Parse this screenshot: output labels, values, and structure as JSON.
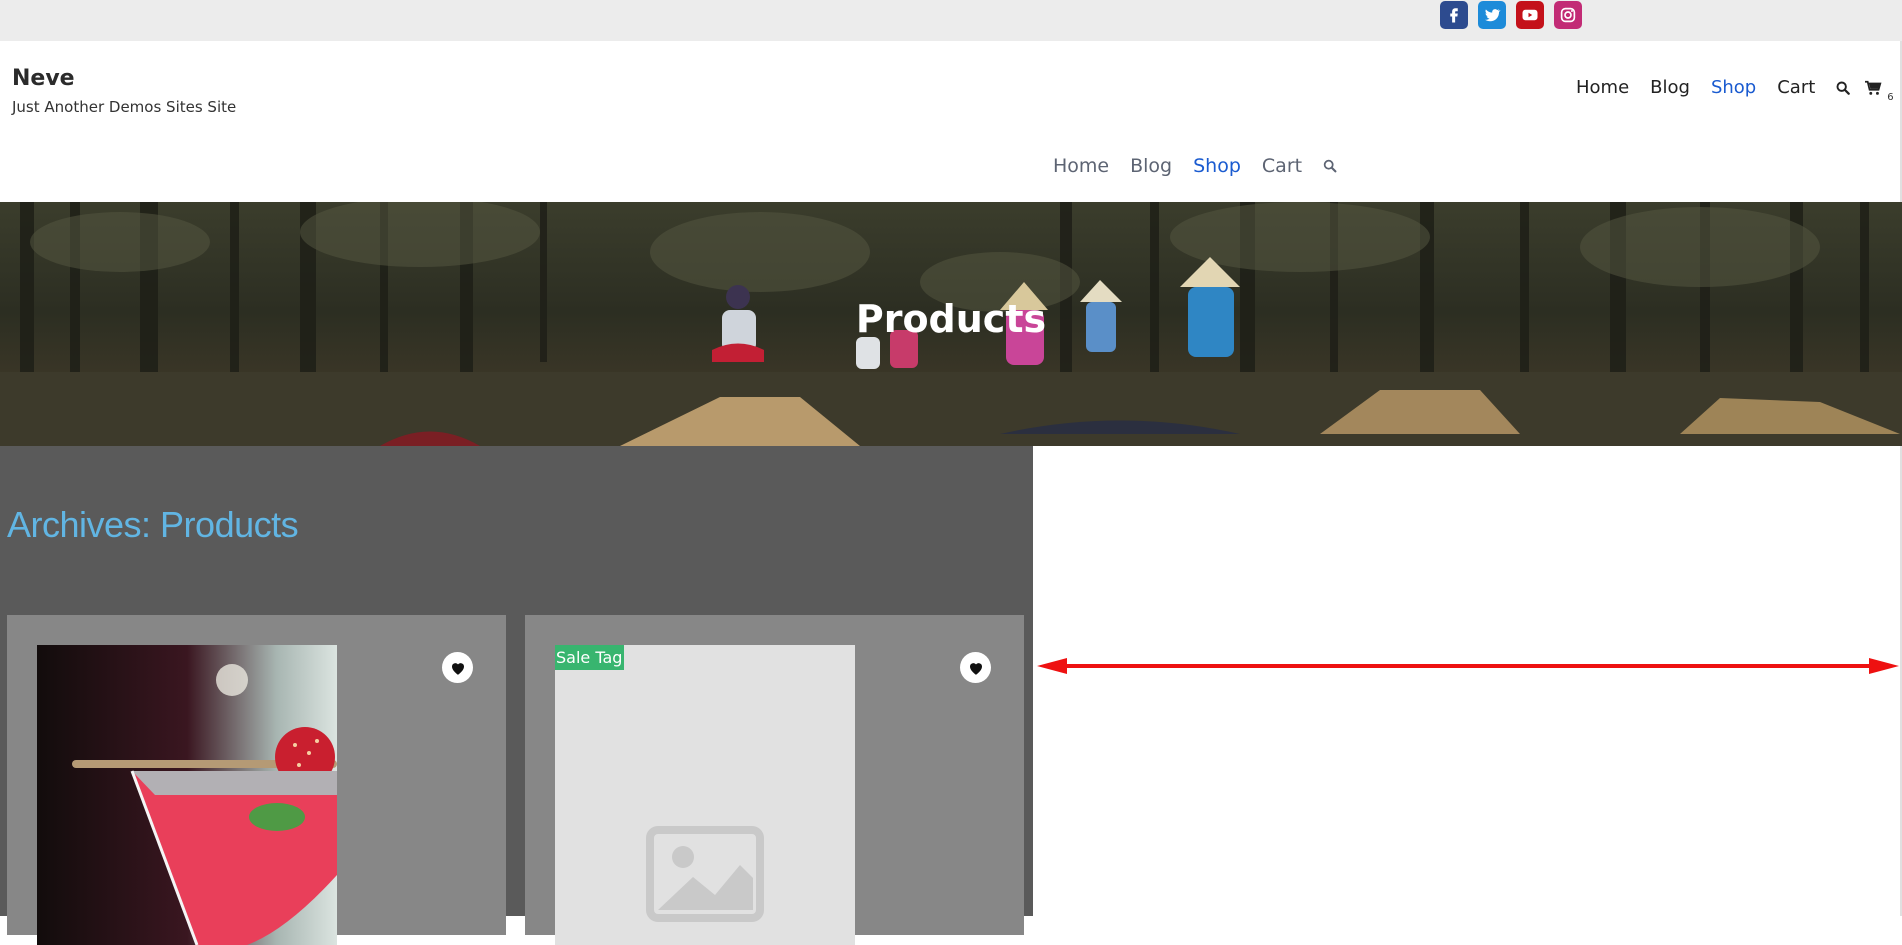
{
  "topbar": {
    "social": [
      "facebook-icon",
      "twitter-icon",
      "youtube-icon",
      "instagram-icon"
    ]
  },
  "header": {
    "site_title": "Neve",
    "tagline": "Just Another Demos Sites Site",
    "primary_nav": [
      "Home",
      "Blog",
      "Shop",
      "Cart"
    ],
    "active": "Shop",
    "cart_count": "6"
  },
  "secondary_nav": [
    "Home",
    "Blog",
    "Shop",
    "Cart"
  ],
  "hero": {
    "title": "Products"
  },
  "archive": {
    "title": "Archives: Products"
  },
  "products": [
    {
      "image": "cocktail-with-strawberry",
      "wishlist_icon": "heart-icon"
    },
    {
      "image": "placeholder-image-icon",
      "badge": "Sale Tag",
      "wishlist_icon": "heart-icon"
    }
  ],
  "colors": {
    "accent_link": "#1a5bd0",
    "archive_title": "#61b5e3",
    "sale_badge": "#38b56f",
    "annotation_arrow": "#ee1111"
  }
}
